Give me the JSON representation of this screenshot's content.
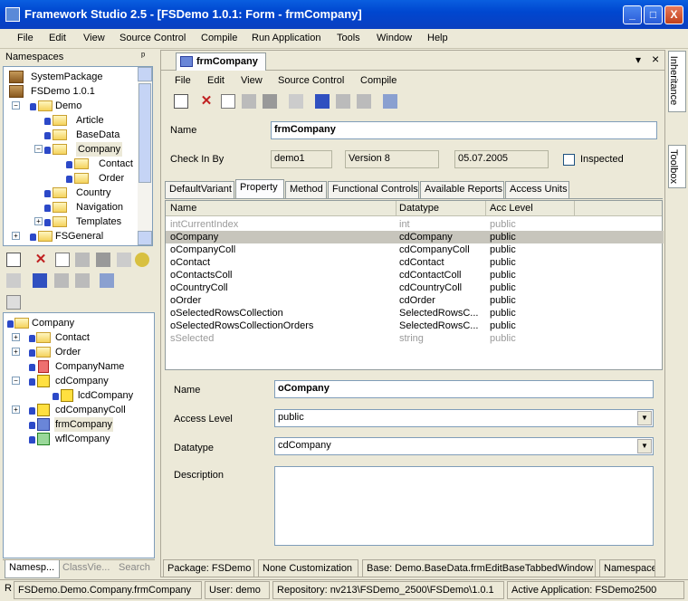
{
  "window": {
    "title": "Framework Studio 2.5 - [FSDemo 1.0.1: Form - frmCompany]",
    "min": "_",
    "max": "□",
    "close": "X"
  },
  "menu": [
    "File",
    "Edit",
    "View",
    "Source Control",
    "Compile",
    "Run Application",
    "Tools",
    "Window",
    "Help"
  ],
  "namespaces": {
    "title": "Namespaces",
    "pin": "ᵖ",
    "tree": [
      "SystemPackage",
      "FSDemo 1.0.1",
      "Demo",
      "Article",
      "BaseData",
      "Company",
      "Contact",
      "Order",
      "Country",
      "Navigation",
      "Templates",
      "FSGeneral"
    ]
  },
  "class_tree": [
    "Company",
    "Contact",
    "Order",
    "CompanyName",
    "cdCompany",
    "lcdCompany",
    "cdCompanyColl",
    "frmCompany",
    "wflCompany"
  ],
  "bottom_tabs": [
    "Namesp...",
    "ClassVie...",
    "Search"
  ],
  "doc": {
    "tab_title": "frmCompany",
    "dropdown": "▾",
    "close": "×",
    "menu": [
      "File",
      "Edit",
      "View",
      "Source Control",
      "Compile"
    ],
    "name_label": "Name",
    "name_value": "frmCompany",
    "checkin_label": "Check In By",
    "user": "demo1",
    "version": "Version 8",
    "date": "05.07.2005",
    "inspected_label": "Inspected",
    "tabs": [
      "DefaultVariant",
      "Property",
      "Method",
      "Functional Controls",
      "Available Reports",
      "Access Units"
    ],
    "grid": {
      "headers": [
        "Name",
        "Datatype",
        "Acc Level"
      ],
      "rows": [
        [
          "intCurrentIndex",
          "int",
          "public"
        ],
        [
          "oCompany",
          "cdCompany",
          "public"
        ],
        [
          "oCompanyColl",
          "cdCompanyColl",
          "public"
        ],
        [
          "oContact",
          "cdContact",
          "public"
        ],
        [
          "oContactsColl",
          "cdContactColl",
          "public"
        ],
        [
          "oCountryColl",
          "cdCountryColl",
          "public"
        ],
        [
          "oOrder",
          "cdOrder",
          "public"
        ],
        [
          "oSelectedRowsCollection",
          "SelectedRowsC...",
          "public"
        ],
        [
          "oSelectedRowsCollectionOrders",
          "SelectedRowsC...",
          "public"
        ],
        [
          "sSelected",
          "string",
          "public"
        ]
      ]
    },
    "detail": {
      "name_label": "Name",
      "name_value": "oCompany",
      "access_label": "Access Level",
      "access_value": "public",
      "datatype_label": "Datatype",
      "datatype_value": "cdCompany",
      "desc_label": "Description"
    },
    "status": [
      "Package: FSDemo",
      "None Customization",
      "Base: Demo.BaseData.frmEditBaseTabbedWindow",
      "Namespace"
    ]
  },
  "side_tabs": [
    "Inheritance",
    "Toolbox"
  ],
  "statusbar": [
    "R",
    "FSDemo.Demo.Company.frmCompany",
    "User: demo",
    "Repository: nv213\\FSDemo_2500\\FSDemo\\1.0.1",
    "Active Application: FSDemo2500"
  ]
}
